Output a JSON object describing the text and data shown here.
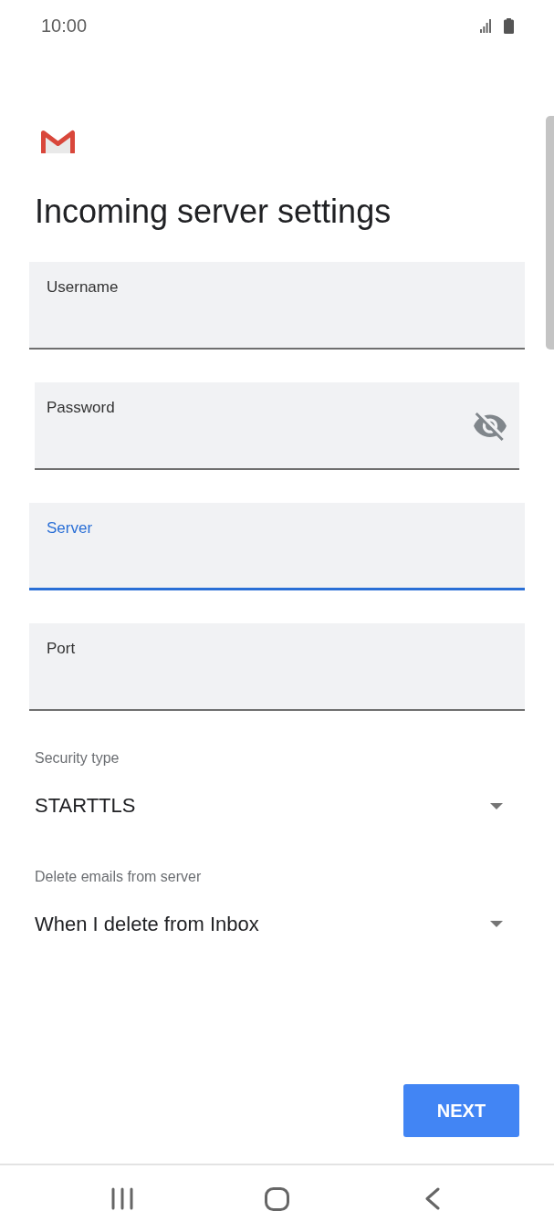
{
  "status_bar": {
    "time": "10:00"
  },
  "title": "Incoming server settings",
  "fields": [
    {
      "kind": "text",
      "label": "Username",
      "focused": false
    },
    {
      "kind": "password",
      "label": "Password",
      "focused": false
    },
    {
      "kind": "text",
      "label": "Server",
      "focused": true
    },
    {
      "kind": "text",
      "label": "Port",
      "focused": false
    }
  ],
  "dropdowns": [
    {
      "label": "Security type",
      "value": "STARTTLS"
    },
    {
      "label": "Delete emails from server",
      "value": "When I delete from Inbox"
    }
  ],
  "next_button": {
    "label": "NEXT"
  }
}
